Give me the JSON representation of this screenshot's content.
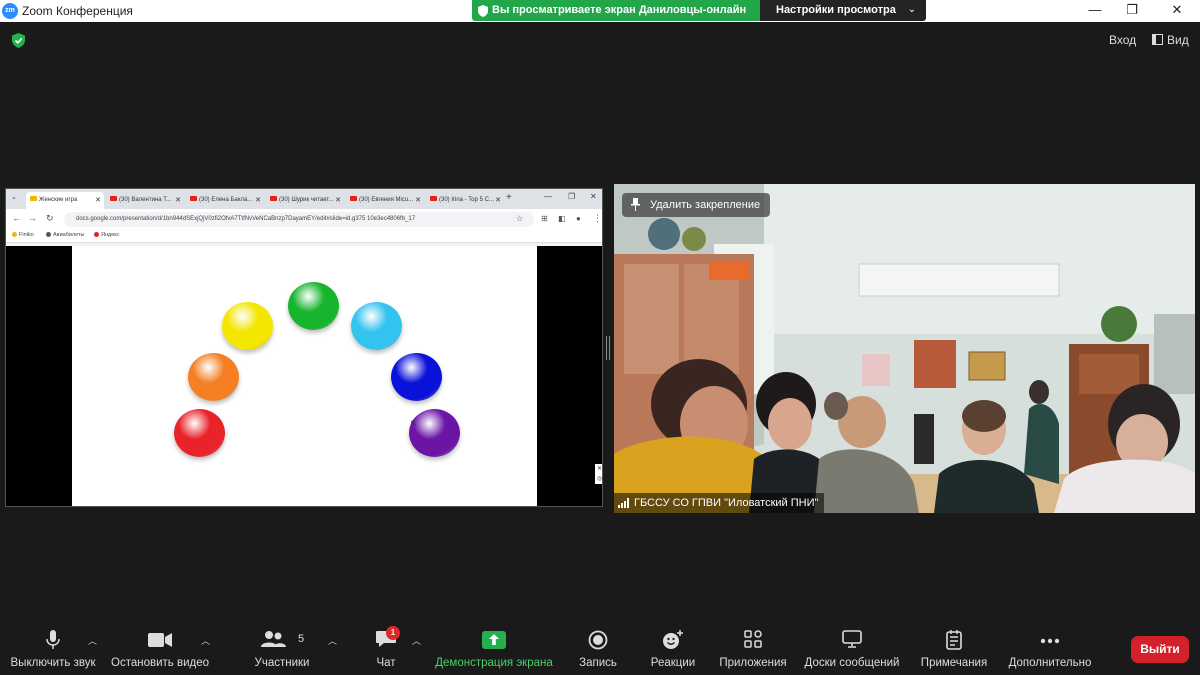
{
  "window": {
    "app_logo": "zm",
    "title": "Zoom Конференция",
    "controls": [
      "—",
      "❐",
      "✕"
    ]
  },
  "share_banner": {
    "text": "Вы просматриваете экран Даниловцы-онлайн",
    "view_settings": "Настройки просмотра",
    "color": "#22a64a"
  },
  "top_right": {
    "enter": "Вход",
    "view": "Вид"
  },
  "browser": {
    "tabs": [
      {
        "label": "Женские игра",
        "icon": "slides-icon"
      },
      {
        "label": "(30) Валентина Т...",
        "icon": "youtube-icon"
      },
      {
        "label": "(30) Елена Бакла...",
        "icon": "youtube-icon"
      },
      {
        "label": "(30) Шурик читает...",
        "icon": "youtube-icon"
      },
      {
        "label": "(30) Евгения Micu...",
        "icon": "youtube-icon"
      },
      {
        "label": "(30) Irina - Top 5 C...",
        "icon": "youtube-icon"
      }
    ],
    "url": "docs.google.com/presentation/d/1bn944dSExjQjV0zfi2OfvA7TtfNvVeNCaBnzp7DayamEY/edit#slide=id.g375 10e3ec4806fb_17",
    "bookmarks": [
      "Finiko",
      "Авиабилеты",
      "Яндекс"
    ],
    "slide_circles": [
      {
        "color_name": "red",
        "color": "#e8232a"
      },
      {
        "color_name": "orange",
        "color": "#f57f22"
      },
      {
        "color_name": "yellow",
        "color": "#f3e600"
      },
      {
        "color_name": "green",
        "color": "#16b52d"
      },
      {
        "color_name": "light-blue",
        "color": "#33c3ef"
      },
      {
        "color_name": "blue",
        "color": "#0a11d9"
      },
      {
        "color_name": "purple",
        "color": "#6b14a6"
      }
    ]
  },
  "video": {
    "unpin": "Удалить закрепление",
    "participant_name": "ГБССУ СО ГПВИ \"Иловатский ПНИ\""
  },
  "toolbar": {
    "mute": "Выключить звук",
    "stop_video": "Остановить видео",
    "participants": "Участники",
    "participants_count": "5",
    "chat": "Чат",
    "chat_badge": "1",
    "share_screen": "Демонстрация экрана",
    "record": "Запись",
    "reactions": "Реакции",
    "apps": "Приложения",
    "whiteboards": "Доски сообщений",
    "notes": "Примечания",
    "more": "Дополнительно",
    "leave": "Выйти"
  }
}
